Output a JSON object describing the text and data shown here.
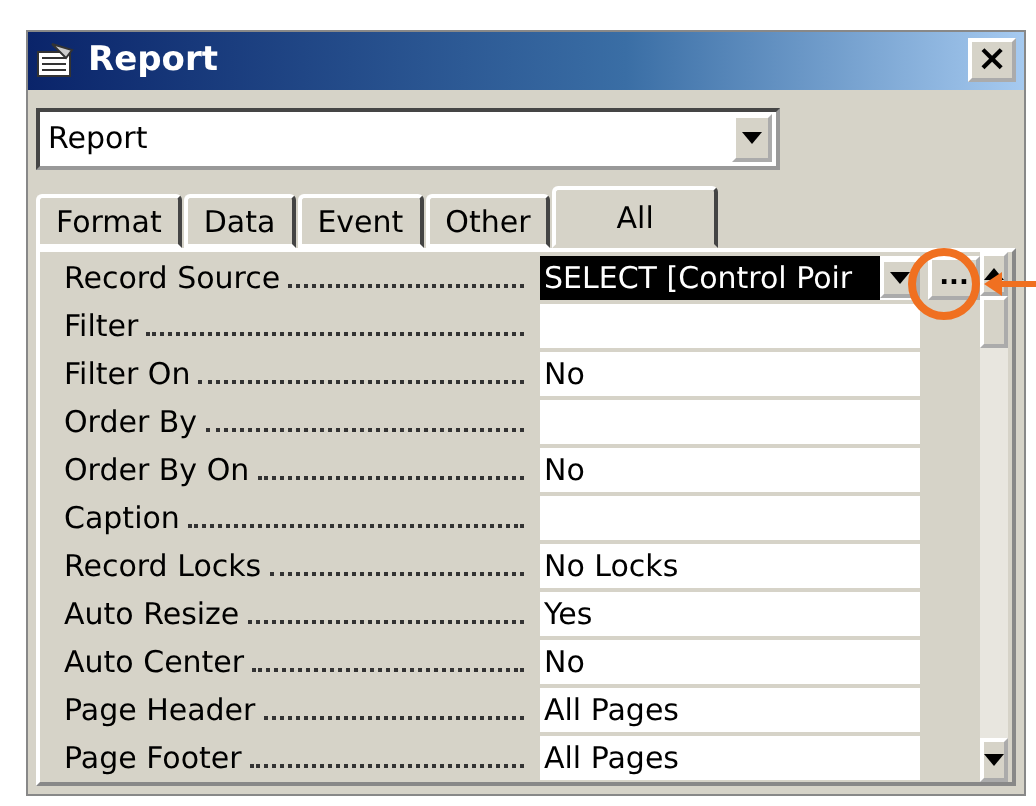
{
  "window": {
    "title": "Report",
    "close": "×"
  },
  "object_combo": {
    "value": "Report"
  },
  "tabs": [
    {
      "label": "Format",
      "selected": false
    },
    {
      "label": "Data",
      "selected": false
    },
    {
      "label": "Event",
      "selected": false
    },
    {
      "label": "Other",
      "selected": false
    },
    {
      "label": "All",
      "selected": true
    }
  ],
  "properties": [
    {
      "name": "Record Source",
      "value": "SELECT [Control Poir",
      "selected": true,
      "kind": "combo",
      "build": "..."
    },
    {
      "name": "Filter",
      "selected": false,
      "kind": "text"
    },
    {
      "name": "Filter On",
      "value": "No",
      "selected": false,
      "kind": "text"
    },
    {
      "name": "Order By",
      "selected": false,
      "kind": "text"
    },
    {
      "name": "Order By On",
      "value": "No",
      "selected": false,
      "kind": "text"
    },
    {
      "name": "Caption",
      "selected": false,
      "kind": "text"
    },
    {
      "name": "Record Locks",
      "value": "No Locks",
      "selected": false,
      "kind": "text"
    },
    {
      "name": "Auto Resize",
      "value": "Yes",
      "selected": false,
      "kind": "text"
    },
    {
      "name": "Auto Center",
      "value": "No",
      "selected": false,
      "kind": "text"
    },
    {
      "name": "Page Header",
      "value": "All Pages",
      "selected": false,
      "kind": "text"
    },
    {
      "name": "Page Footer",
      "value": "All Pages",
      "selected": false,
      "kind": "text"
    }
  ]
}
